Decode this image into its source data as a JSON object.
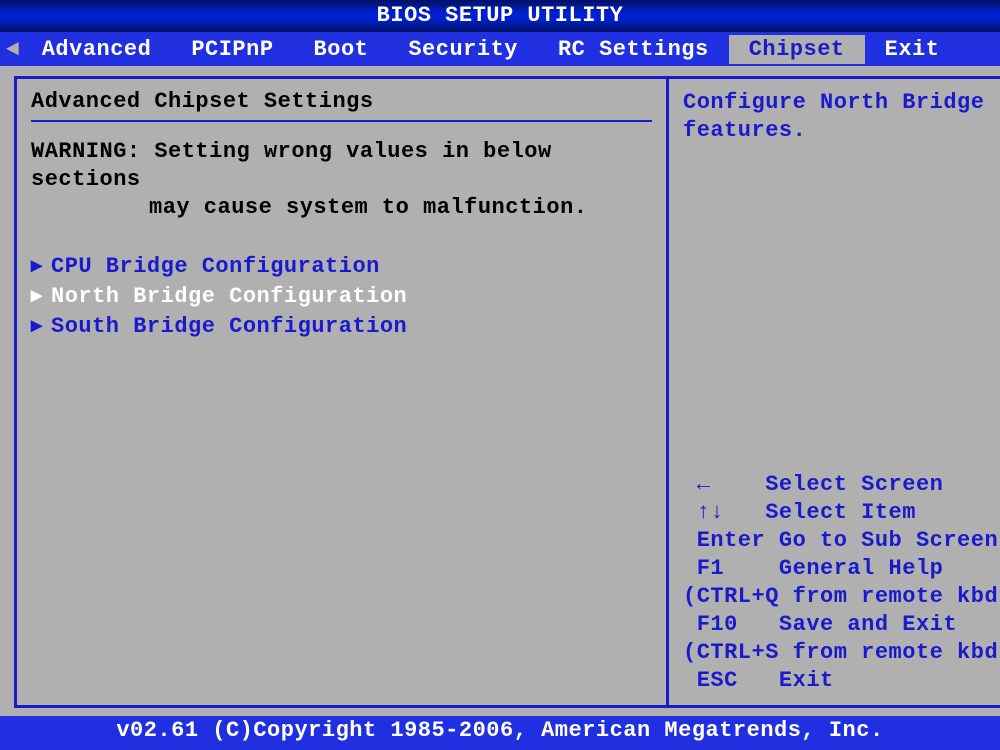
{
  "title": "BIOS SETUP UTILITY",
  "menu": {
    "items": [
      "Advanced",
      "PCIPnP",
      "Boot",
      "Security",
      "RC Settings",
      "Chipset",
      "Exit"
    ],
    "selected_index": 5
  },
  "left_panel": {
    "heading": "Advanced Chipset Settings",
    "warning_label": "WARNING:",
    "warning_line1": "Setting wrong values in below sections",
    "warning_line2": "may cause system to malfunction.",
    "entries": [
      {
        "label": "CPU Bridge Configuration",
        "active": false
      },
      {
        "label": "North Bridge Configuration",
        "active": true
      },
      {
        "label": "South Bridge Configuration",
        "active": false
      }
    ]
  },
  "right_panel": {
    "context_help": "Configure North Bridge features.",
    "keys": [
      {
        "key": "←",
        "desc": "Select Screen"
      },
      {
        "key": "↑↓",
        "desc": "Select Item"
      },
      {
        "key": "Enter",
        "desc": "Go to Sub Screen"
      },
      {
        "key": "F1",
        "desc": "General Help"
      },
      {
        "note": "(CTRL+Q from remote kbd)"
      },
      {
        "key": "F10",
        "desc": "Save and Exit"
      },
      {
        "note": "(CTRL+S from remote kbd)"
      },
      {
        "key": "ESC",
        "desc": "Exit"
      }
    ]
  },
  "footer": "v02.61 (C)Copyright 1985-2006, American Megatrends, Inc."
}
